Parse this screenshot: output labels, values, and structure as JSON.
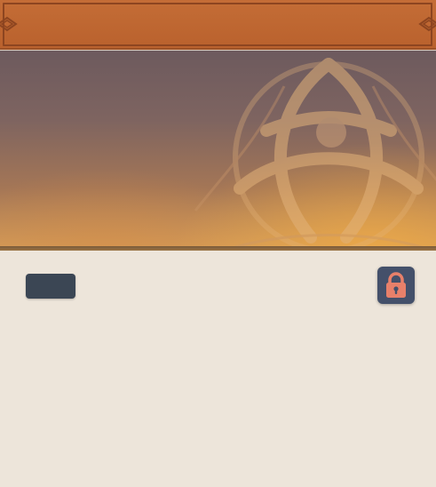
{
  "header": {
    "accent_color": "#b9612d",
    "frame_color": "#8d4520",
    "left_ornament": "celtic-knot-end-icon",
    "right_ornament": "celtic-knot-end-icon"
  },
  "banner": {
    "pattern": "triquetra-knot-icon",
    "gradient_top": "#6d5a5e",
    "gradient_bottom": "#d29a58"
  },
  "toolbar": {
    "action_button_label": "",
    "lock_icon": "lock-icon",
    "lock_color": "#e8806a"
  }
}
